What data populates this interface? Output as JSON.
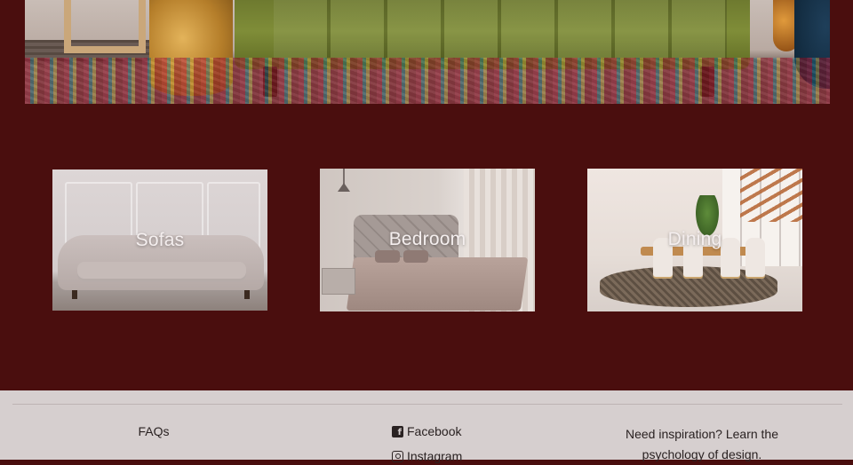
{
  "hero": {
    "alt": "green velvet sofa on a colorful rug"
  },
  "categories": [
    {
      "label": "Sofas"
    },
    {
      "label": "Bedroom"
    },
    {
      "label": "Dining"
    }
  ],
  "footer": {
    "faqs": "FAQs",
    "facebook": "Facebook",
    "instagram": "Instagram",
    "inspiration_line1": "Need inspiration? Learn the",
    "inspiration_line2": "psychology of design."
  },
  "colors": {
    "page_bg": "#4a0e0e",
    "footer_bg": "#d6cfcf",
    "text_dark": "#2a2222"
  }
}
